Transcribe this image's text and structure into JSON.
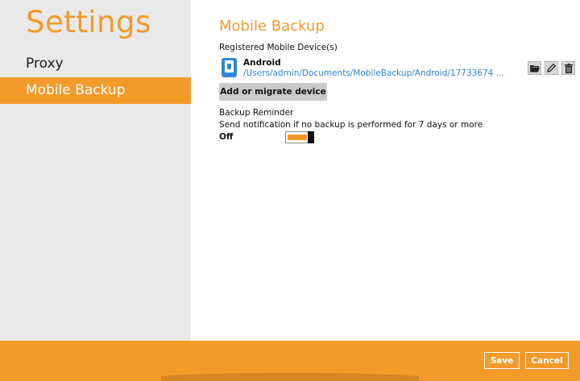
{
  "sidebar": {
    "title": "Settings",
    "items": [
      {
        "label": "Proxy"
      },
      {
        "label": "Mobile Backup"
      }
    ]
  },
  "main": {
    "title": "Mobile Backup",
    "registered_label": "Registered Mobile Device(s)",
    "device": {
      "name": "Android",
      "path": "/Users/admin/Documents/MobileBackup/Android/17733674 ..."
    },
    "add_button": "Add or migrate device",
    "reminder_label": "Backup Reminder",
    "notify_prefix": "Send notification if",
    "notify_condition": "no backup is performed for",
    "notify_period": "7 days or more",
    "toggle_state": "Off"
  },
  "footer": {
    "save": "Save",
    "cancel": "Cancel"
  },
  "colors": {
    "accent": "#f39a2b",
    "link": "#2f86d6",
    "sidebar_bg": "#e9e9e9"
  }
}
